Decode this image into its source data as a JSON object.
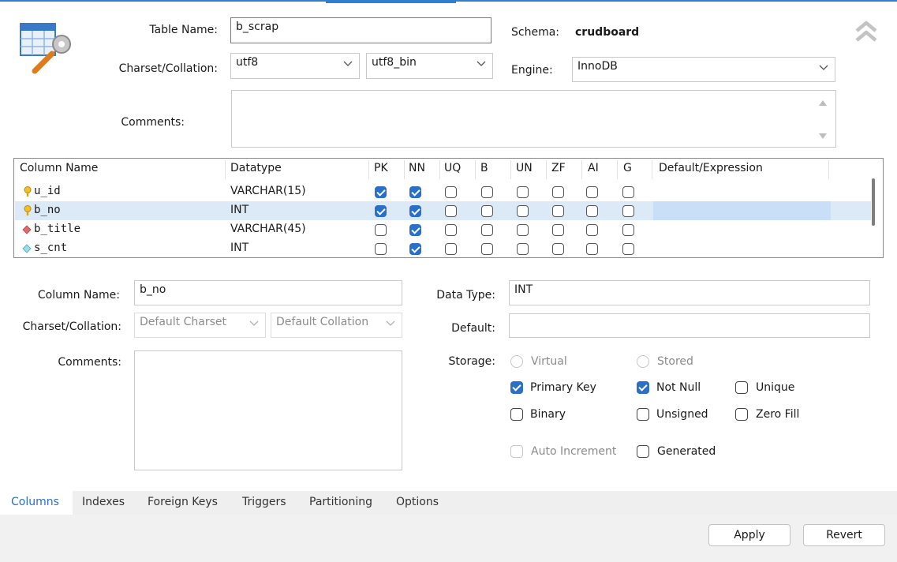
{
  "table": {
    "name_label": "Table Name:",
    "name_value": "b_scrap",
    "schema_label": "Schema:",
    "schema_value": "crudboard",
    "charset_label": "Charset/Collation:",
    "charset_value": "utf8",
    "collation_value": "utf8_bin",
    "engine_label": "Engine:",
    "engine_value": "InnoDB",
    "comments_label": "Comments:",
    "comments_value": ""
  },
  "grid": {
    "headers": [
      "Column Name",
      "Datatype",
      "PK",
      "NN",
      "UQ",
      "B",
      "UN",
      "ZF",
      "AI",
      "G",
      "Default/Expression"
    ],
    "rows": [
      {
        "name": "u_id",
        "datatype": "VARCHAR(15)",
        "icon": "primary-key-icon",
        "flags": [
          true,
          true,
          false,
          false,
          false,
          false,
          false,
          false
        ],
        "selected": false
      },
      {
        "name": "b_no",
        "datatype": "INT",
        "icon": "primary-key-icon",
        "flags": [
          true,
          true,
          false,
          false,
          false,
          false,
          false,
          false
        ],
        "selected": true
      },
      {
        "name": "b_title",
        "datatype": "VARCHAR(45)",
        "icon": "not-null-diamond-icon",
        "flags": [
          false,
          true,
          false,
          false,
          false,
          false,
          false,
          false
        ],
        "selected": false
      },
      {
        "name": "s_cnt",
        "datatype": "INT",
        "icon": "nullable-diamond-icon",
        "flags": [
          false,
          true,
          false,
          false,
          false,
          false,
          false,
          false
        ],
        "selected": false
      }
    ]
  },
  "detail": {
    "column_name_label": "Column Name:",
    "column_name_value": "b_no",
    "charset_label": "Charset/Collation:",
    "charset_value": "Default Charset",
    "collation_value": "Default Collation",
    "comments_label": "Comments:",
    "data_type_label": "Data Type:",
    "data_type_value": "INT",
    "default_label": "Default:",
    "default_value": "",
    "storage_label": "Storage:",
    "virtual_label": "Virtual",
    "stored_label": "Stored",
    "primary_key_label": "Primary Key",
    "not_null_label": "Not Null",
    "unique_label": "Unique",
    "binary_label": "Binary",
    "unsigned_label": "Unsigned",
    "zero_fill_label": "Zero Fill",
    "auto_increment_label": "Auto Increment",
    "generated_label": "Generated",
    "checked": {
      "primary_key": true,
      "not_null": true,
      "unique": false,
      "binary": false,
      "unsigned": false,
      "zero_fill": false,
      "auto_increment": false,
      "generated": false
    }
  },
  "tabs": [
    "Columns",
    "Indexes",
    "Foreign Keys",
    "Triggers",
    "Partitioning",
    "Options"
  ],
  "buttons": {
    "apply": "Apply",
    "revert": "Revert"
  },
  "colors": {
    "accent": "#2a6fc9",
    "selection": "#dce9f7"
  }
}
